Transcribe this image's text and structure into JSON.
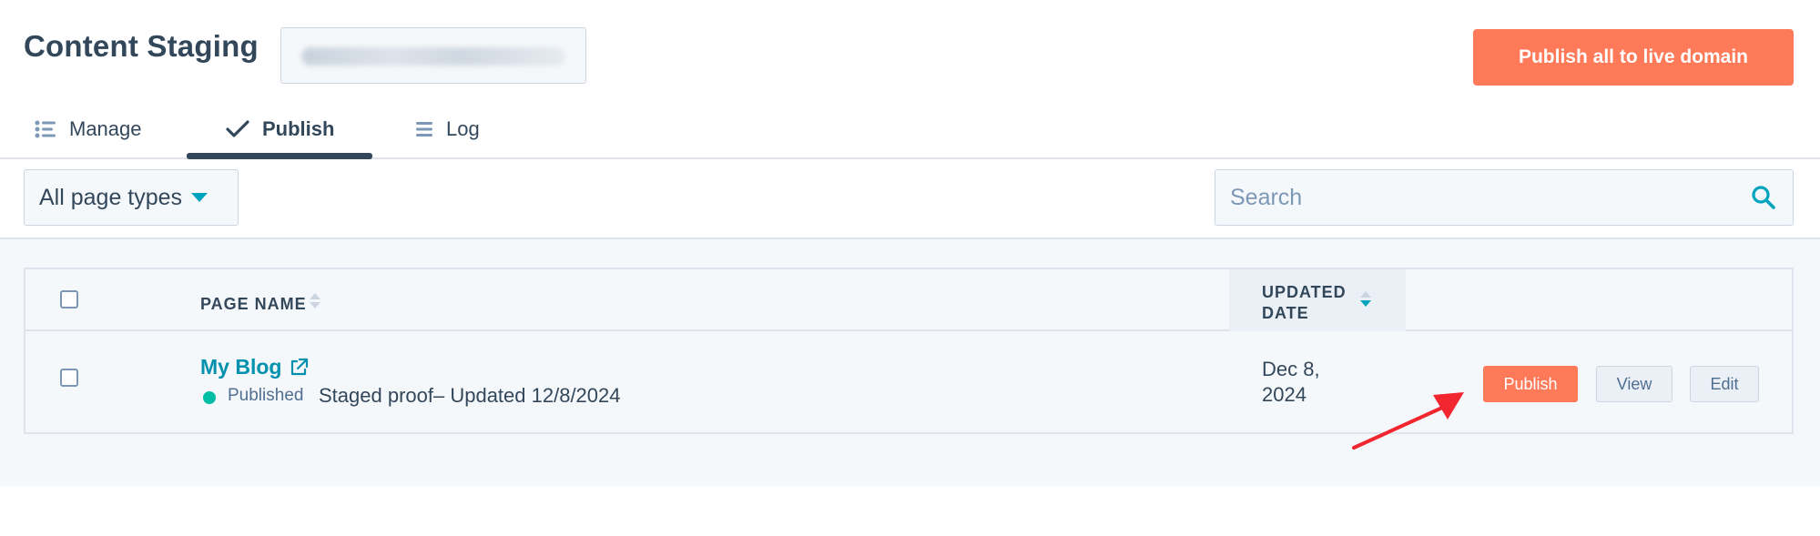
{
  "header": {
    "title": "Content Staging",
    "publish_all_label": "Publish all to live domain"
  },
  "tabs": [
    {
      "label": "Manage",
      "icon": "list-icon"
    },
    {
      "label": "Publish",
      "icon": "checkmark-icon",
      "active": true
    },
    {
      "label": "Log",
      "icon": "lines-icon"
    }
  ],
  "filters": {
    "page_type": "All page types",
    "search_placeholder": "Search"
  },
  "table": {
    "columns": [
      "PAGE NAME",
      "UPDATED DATE"
    ],
    "sorted_column": "UPDATED DATE",
    "rows": [
      {
        "name": "My Blog",
        "status": "Published",
        "note": "Staged proof– Updated 12/8/2024",
        "updated": "Dec 8, 2024",
        "actions": [
          "Publish",
          "View",
          "Edit"
        ]
      }
    ]
  },
  "colors": {
    "accent_orange": "#ff7a59",
    "link_teal": "#0091ae",
    "status_green": "#00bda5",
    "annotation_red": "#f2262f",
    "text_dark": "#33475b"
  }
}
